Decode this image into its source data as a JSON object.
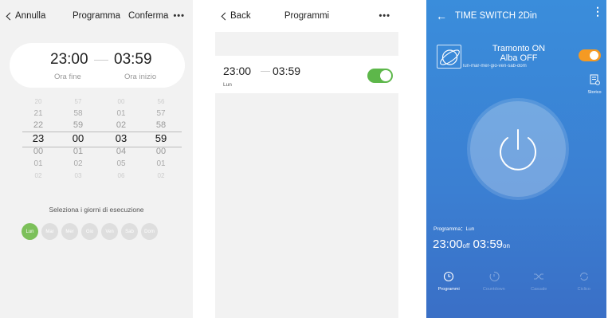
{
  "edit_screen": {
    "nav": {
      "cancel": "Annulla",
      "title": "Programma",
      "confirm": "Conferma",
      "more": "•••"
    },
    "end_time": "23:00",
    "start_time": "03:59",
    "end_label": "Ora fine",
    "start_label": "Ora inizio",
    "wheels": [
      {
        "unit": "end-hour",
        "values": [
          "20",
          "21",
          "22",
          "23",
          "00",
          "01",
          "02"
        ]
      },
      {
        "unit": "end-minute",
        "values": [
          "57",
          "58",
          "59",
          "00",
          "01",
          "02",
          "03"
        ]
      },
      {
        "unit": "start-hour",
        "values": [
          "00",
          "01",
          "02",
          "03",
          "04",
          "05",
          "06"
        ]
      },
      {
        "unit": "start-minute",
        "values": [
          "56",
          "57",
          "58",
          "59",
          "00",
          "01",
          "02"
        ]
      }
    ],
    "days_title": "Seleziona i giorni di esecuzione",
    "days": [
      {
        "label": "Lun",
        "selected": true
      },
      {
        "label": "Mar",
        "selected": false
      },
      {
        "label": "Mer",
        "selected": false
      },
      {
        "label": "Gio",
        "selected": false
      },
      {
        "label": "Ven",
        "selected": false
      },
      {
        "label": "Sab",
        "selected": false
      },
      {
        "label": "Dom",
        "selected": false
      }
    ]
  },
  "list_screen": {
    "nav": {
      "back": "Back",
      "title": "Programmi",
      "more": "•••"
    },
    "items": [
      {
        "start": "23:00",
        "end": "03:59",
        "days": "Lun",
        "enabled": true
      }
    ]
  },
  "device_screen": {
    "title": "TIME SWITCH 2Din",
    "back_icon": "←",
    "menu_icon": "⋮",
    "status_line1": "Tramonto ON",
    "status_line2": "Alba OFF",
    "days": "lun-mar-mer-gio-ven-sab-dom",
    "switch_on": true,
    "history_label": "Storico",
    "program_label": "Programma：Lun",
    "off_time": "23:00",
    "off_suffix": "off",
    "on_time": "03:59",
    "on_suffix": "on",
    "tabs": [
      {
        "label": "Programmi",
        "icon": "clock-icon",
        "active": true
      },
      {
        "label": "Countdown",
        "icon": "countdown-icon",
        "active": false
      },
      {
        "label": "Casuale",
        "icon": "shuffle-icon",
        "active": false
      },
      {
        "label": "Ciclico",
        "icon": "cycle-icon",
        "active": false
      }
    ],
    "colors": {
      "background": "#3a86d6",
      "toggle_on": "#f59a23"
    }
  }
}
